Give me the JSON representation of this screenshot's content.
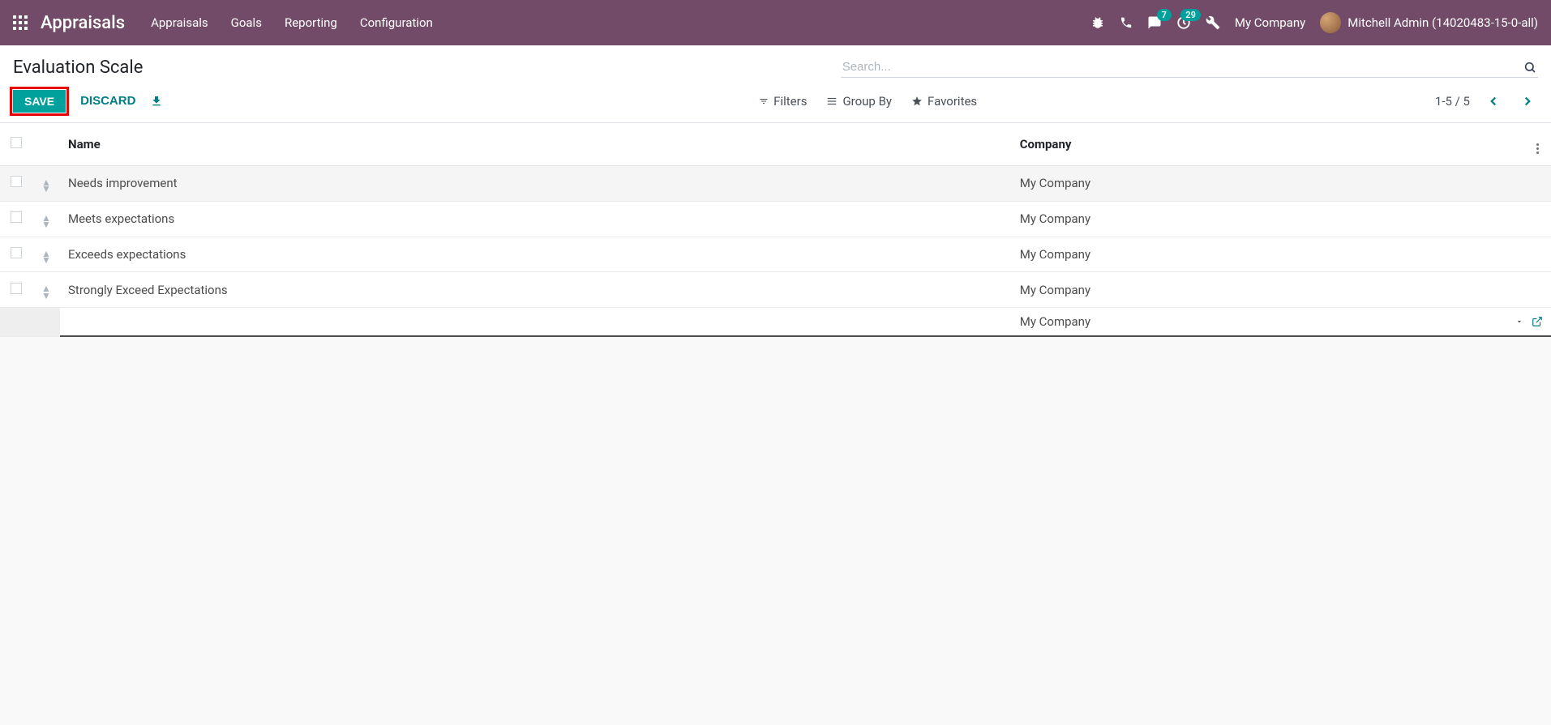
{
  "navbar": {
    "app_title": "Appraisals",
    "menu": [
      "Appraisals",
      "Goals",
      "Reporting",
      "Configuration"
    ],
    "chat_badge": "7",
    "activity_badge": "29",
    "company": "My Company",
    "user": "Mitchell Admin (14020483-15-0-all)"
  },
  "control_panel": {
    "title": "Evaluation Scale",
    "search_placeholder": "Search...",
    "save_label": "SAVE",
    "discard_label": "DISCARD",
    "filters_label": "Filters",
    "groupby_label": "Group By",
    "favorites_label": "Favorites",
    "pager": "1-5 / 5"
  },
  "table": {
    "headers": {
      "name": "Name",
      "company": "Company"
    },
    "rows": [
      {
        "name": "Needs improvement",
        "company": "My Company"
      },
      {
        "name": "Meets expectations",
        "company": "My Company"
      },
      {
        "name": "Exceeds expectations",
        "company": "My Company"
      },
      {
        "name": "Strongly Exceed Expectations",
        "company": "My Company"
      }
    ],
    "edit_row": {
      "name": "",
      "company": "My Company"
    }
  }
}
